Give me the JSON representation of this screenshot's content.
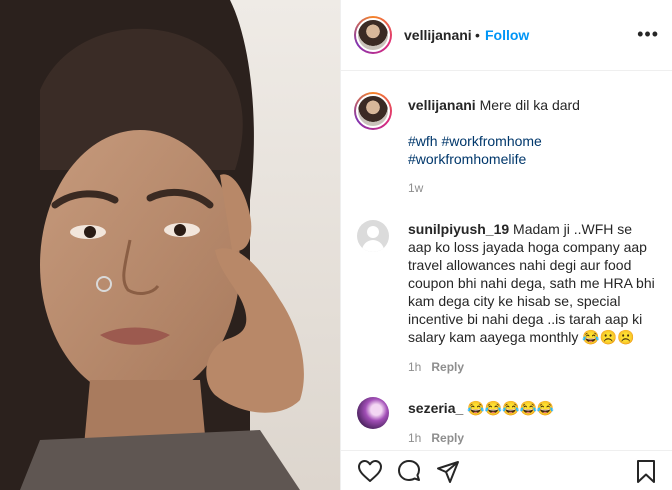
{
  "post": {
    "username": "vellijanani",
    "separator": "•",
    "follow_label": "Follow",
    "more_label": "•••",
    "caption": {
      "username": "vellijanani",
      "text": "Mere dil ka dard",
      "hashtags": [
        "#wfh",
        "#workfromhome",
        "#workfromhomelife"
      ],
      "age": "1w"
    },
    "comments": [
      {
        "username": "sunilpiyush_19",
        "text": "Madam ji ..WFH se aap ko loss jayada hoga company aap travel allowances nahi degi aur food coupon bhi nahi dega, sath me HRA bhi kam dega city ke hisab se, special incentive bi nahi dega ..is tarah aap ki salary kam aayega monthly 😂☹️☹️",
        "age": "1h",
        "reply_label": "Reply"
      },
      {
        "username": "sezeria_",
        "text": "😂😂😂😂😂",
        "age": "1h",
        "reply_label": "Reply"
      }
    ]
  },
  "icons": {
    "like": "heart-icon",
    "comment": "comment-icon",
    "share": "share-icon",
    "save": "bookmark-icon"
  },
  "colors": {
    "follow": "#0095f6",
    "hashtag": "#00376b",
    "muted": "#8e8e8e",
    "text": "#262626"
  }
}
